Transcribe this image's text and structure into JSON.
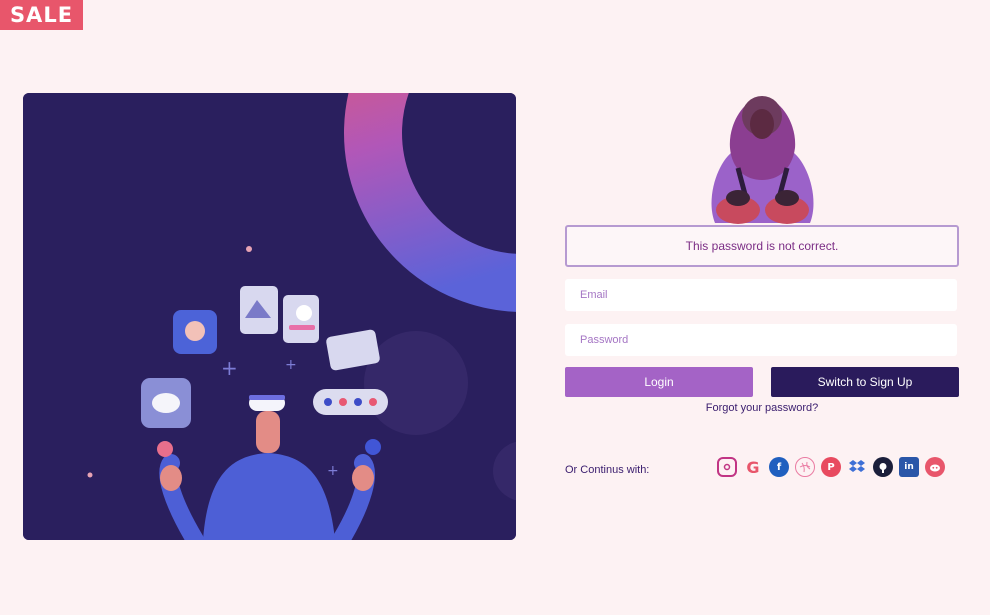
{
  "badge": {
    "label": "SALE"
  },
  "alert": {
    "message": "This password is not correct."
  },
  "form": {
    "email_placeholder": "Email",
    "password_placeholder": "Password",
    "login_label": "Login",
    "signup_label": "Switch to Sign Up",
    "forgot_label": "Forgot your password?"
  },
  "social": {
    "label": "Or Continus with:",
    "icons": [
      {
        "name": "instagram-icon",
        "color": "#c13584"
      },
      {
        "name": "google-icon",
        "color": "#e8566b"
      },
      {
        "name": "facebook-icon",
        "color": "#1f5fbf"
      },
      {
        "name": "dribbble-icon",
        "color": "#ea7ba2"
      },
      {
        "name": "pinterest-icon",
        "color": "#e84a5f"
      },
      {
        "name": "dropbox-icon",
        "color": "#3d6fd6"
      },
      {
        "name": "github-icon",
        "color": "#1b1f3b"
      },
      {
        "name": "linkedin-icon",
        "color": "#2a56a8"
      },
      {
        "name": "reddit-icon",
        "color": "#e8566b"
      }
    ]
  },
  "colors": {
    "page_bg": "#fdf2f3",
    "hero_bg": "#2a1f5e",
    "login_button": "#a463c6",
    "signup_button": "#2a1b5c",
    "badge": "#e8566b"
  }
}
